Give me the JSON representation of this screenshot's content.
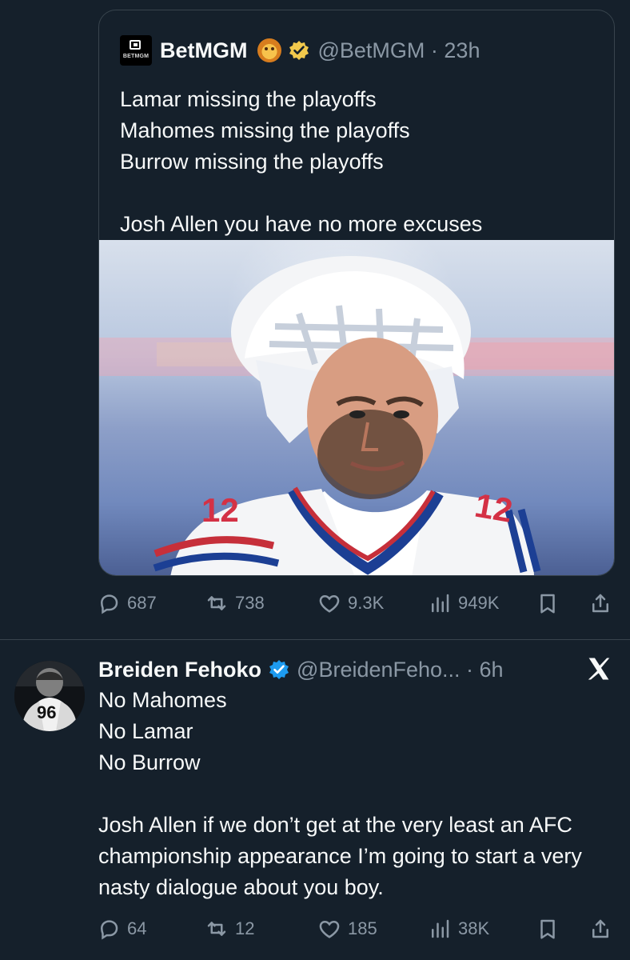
{
  "colors": {
    "background": "#15202b",
    "text": "#f7f9f9",
    "muted": "#8b98a5",
    "border": "#38444d",
    "verified_blue": "#1d9bf0",
    "verified_gold": "#f2c94c"
  },
  "quoted_tweet": {
    "logo_text": "BETMGM",
    "name": "BetMGM",
    "emoji": "lion-emoji",
    "badge": "gold-verified-icon",
    "handle_time": "@BetMGM · 23h",
    "text": "Lamar missing the playoffs\nMahomes missing the playoffs\nBurrow missing the playoffs\n\nJosh Allen you have no more excuses",
    "image": {
      "subject": "football player photo",
      "jersey_number": "12"
    },
    "stats": {
      "replies": "687",
      "retweets": "738",
      "likes": "9.3K",
      "views": "949K"
    },
    "icons": {
      "reply": "reply-icon",
      "retweet": "retweet-icon",
      "like": "heart-icon",
      "views": "views-icon",
      "bookmark": "bookmark-icon",
      "share": "share-icon"
    }
  },
  "reply_tweet": {
    "avatar_number": "96",
    "name": "Breiden Fehoko",
    "badge": "blue-verified-icon",
    "handle_time": "@BreidenFeho... · 6h",
    "text": "No Mahomes\nNo Lamar\nNo Burrow\n\nJosh Allen if we don’t get at the very least an AFC championship appearance I’m going to start a very nasty dialogue about you boy.",
    "platform_icon": "x-logo-icon",
    "stats": {
      "replies": "64",
      "retweets": "12",
      "likes": "185",
      "views": "38K"
    },
    "icons": {
      "reply": "reply-icon",
      "retweet": "retweet-icon",
      "like": "heart-icon",
      "views": "views-icon",
      "bookmark": "bookmark-icon",
      "share": "share-icon"
    }
  }
}
